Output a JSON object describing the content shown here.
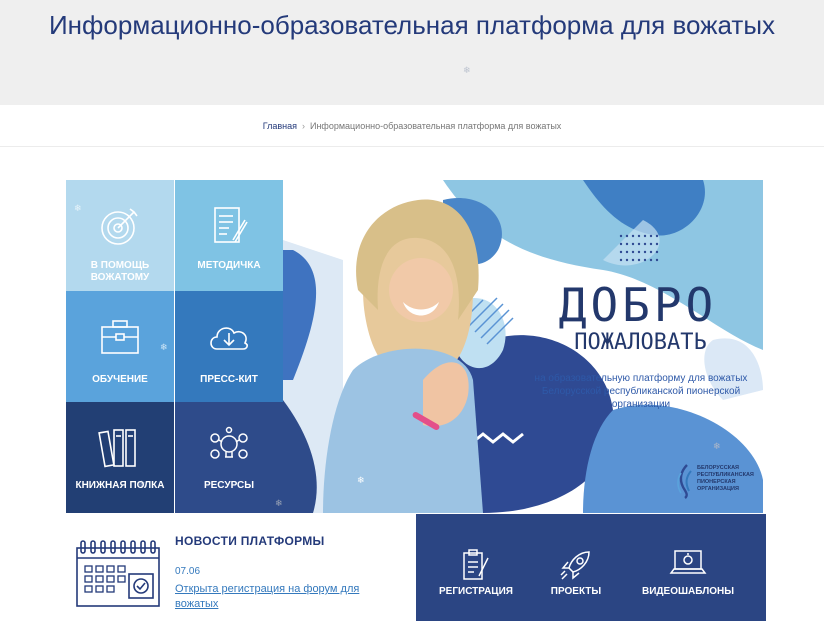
{
  "header": {
    "title": "Информационно-образовательная платформа для вожатых"
  },
  "breadcrumb": {
    "home": "Главная",
    "separator": "›",
    "current": "Информационно-образовательная платформа для вожатых"
  },
  "tiles": [
    {
      "label": "В ПОМОЩЬ ВОЖАТОМУ",
      "icon": "target-icon"
    },
    {
      "label": "МЕТОДИЧКА",
      "icon": "document-pencil-icon"
    },
    {
      "label": "ОБУЧЕНИЕ",
      "icon": "briefcase-icon"
    },
    {
      "label": "ПРЕСС-КИТ",
      "icon": "cloud-download-icon"
    },
    {
      "label": "КНИЖНАЯ ПОЛКА",
      "icon": "books-icon"
    },
    {
      "label": "РЕСУРСЫ",
      "icon": "lightbulb-gears-icon"
    }
  ],
  "banner": {
    "title": "ДОБРО",
    "subtitle": "ПОЖАЛОВАТЬ",
    "description": "на образовательную платформу для вожатых Белорусской республиканской пионерской организации",
    "org_name": "БЕЛОРУССКАЯ РЕСПУБЛИКАНСКАЯ ПИОНЕРСКАЯ ОРГАНИЗАЦИЯ"
  },
  "news": {
    "heading": "НОВОСТИ ПЛАТФОРМЫ",
    "date": "07.06",
    "link": "Открыта регистрация на форум для вожатых"
  },
  "quick_links": [
    {
      "label": "РЕГИСТРАЦИЯ",
      "icon": "clipboard-pen-icon"
    },
    {
      "label": "ПРОЕКТЫ",
      "icon": "rocket-icon"
    },
    {
      "label": "ВИДЕОШАБЛОНЫ",
      "icon": "laptop-icon"
    }
  ],
  "colors": {
    "brand_dark": "#243a7a",
    "tile_light": "#b3d9ee",
    "tile_sky": "#7fc3e4",
    "tile_blue": "#5aa3dc",
    "tile_mid": "#3479bd",
    "tile_navy": "#223f74",
    "tile_indigo": "#2e4b8a",
    "panel": "#2b4583"
  }
}
